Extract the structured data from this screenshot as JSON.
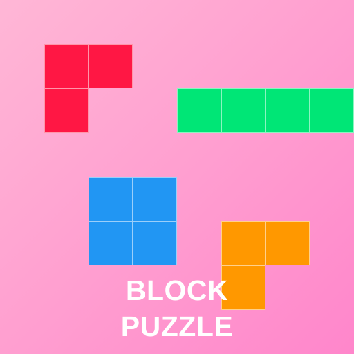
{
  "title": {
    "line1": "BLOCK",
    "line2": "PUZZLE"
  },
  "colors": {
    "background_start": "#ffb7d6",
    "background_end": "#ff86cb",
    "red": "#ff1744",
    "green": "#00e676",
    "blue": "#2196f3",
    "orange": "#ff9800",
    "text": "#ffffff"
  },
  "pieces": [
    {
      "name": "red-l-piece",
      "color": "#ff1744",
      "cells": [
        [
          1,
          1
        ],
        [
          2,
          1
        ],
        [
          1,
          2
        ]
      ]
    },
    {
      "name": "green-i-piece",
      "color": "#00e676",
      "cells": [
        [
          4,
          2
        ],
        [
          5,
          2
        ],
        [
          6,
          2
        ],
        [
          7,
          2
        ]
      ]
    },
    {
      "name": "blue-o-piece",
      "color": "#2196f3",
      "cells": [
        [
          2,
          4
        ],
        [
          3,
          4
        ],
        [
          2,
          5
        ],
        [
          3,
          5
        ]
      ]
    },
    {
      "name": "orange-l-piece",
      "color": "#ff9800",
      "cells": [
        [
          5,
          5
        ],
        [
          6,
          5
        ],
        [
          5,
          6
        ]
      ]
    }
  ]
}
